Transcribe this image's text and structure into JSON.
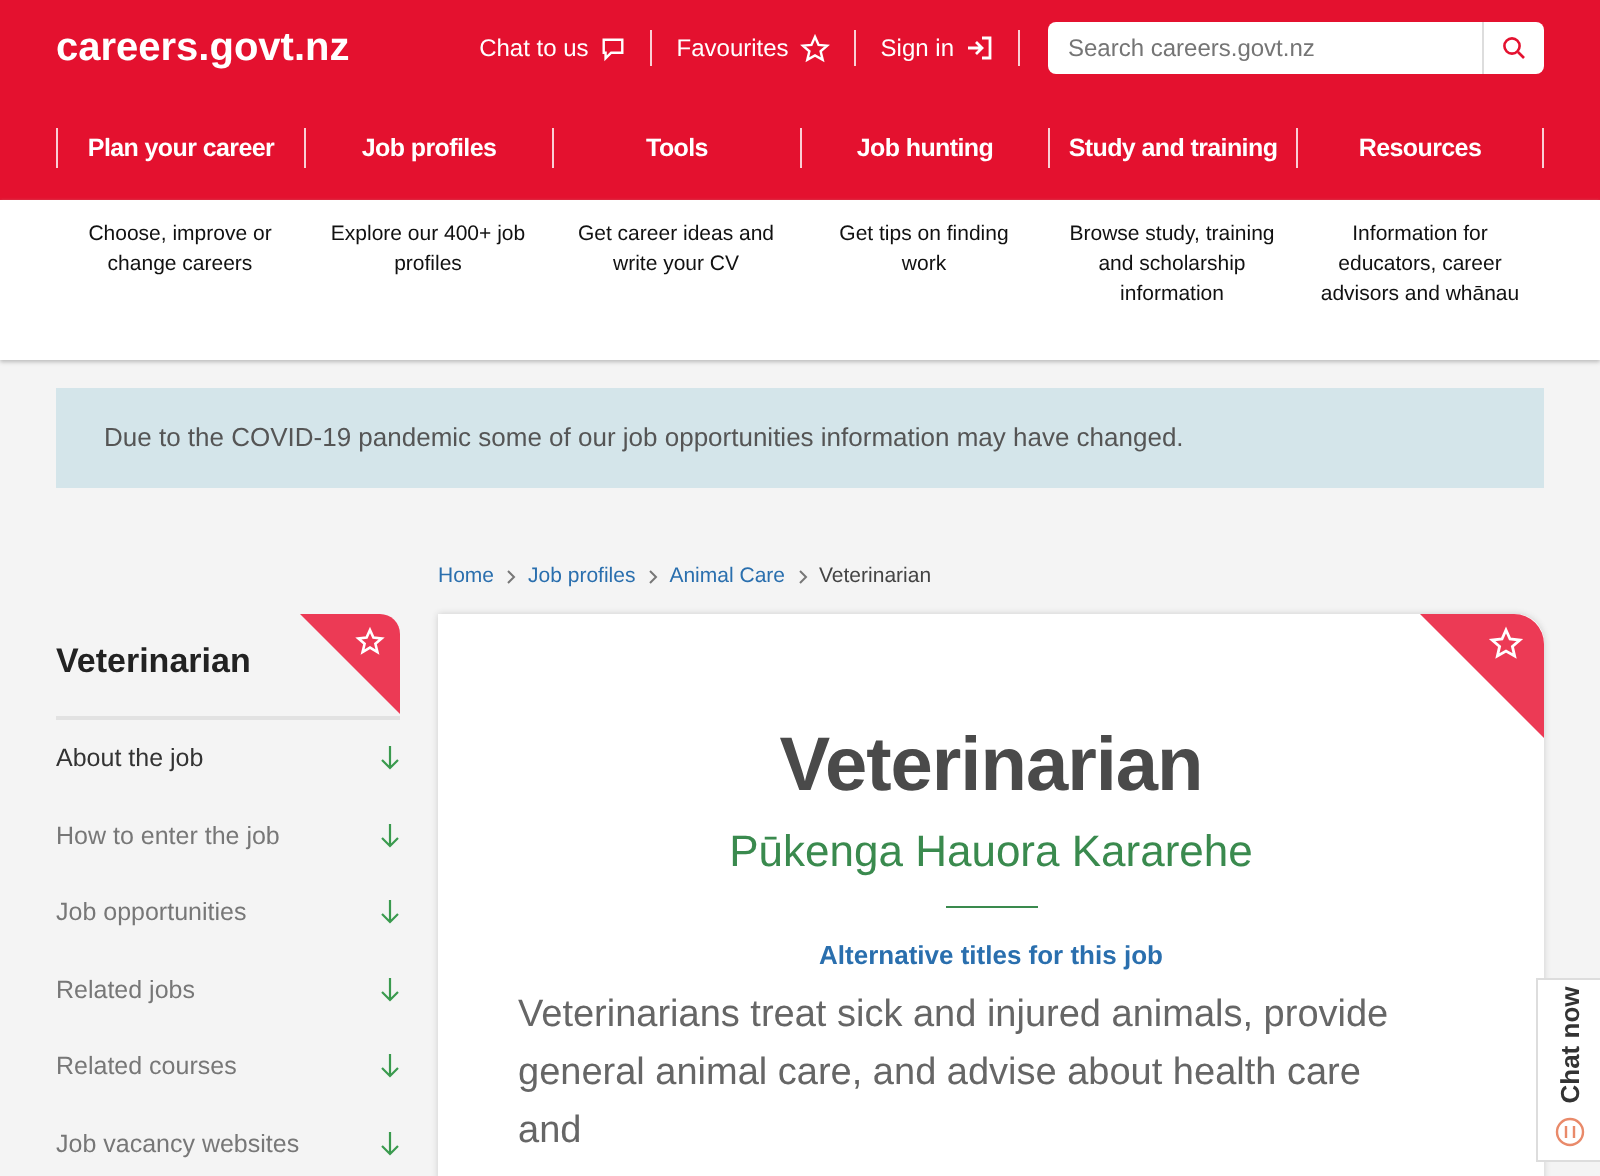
{
  "header": {
    "logo": "careers.govt.nz",
    "links": [
      {
        "label": "Chat to us",
        "kind": "chat"
      },
      {
        "label": "Favourites",
        "kind": "star"
      },
      {
        "label": "Sign in",
        "kind": "signin"
      }
    ],
    "search": {
      "placeholder": "Search careers.govt.nz"
    }
  },
  "nav": [
    {
      "label": "Plan your career",
      "description": "Choose, improve or change careers"
    },
    {
      "label": "Job profiles",
      "description": "Explore our 400+ job profiles"
    },
    {
      "label": "Tools",
      "description": "Get career ideas and write your CV"
    },
    {
      "label": "Job hunting",
      "description": "Get tips on finding work"
    },
    {
      "label": "Study and training",
      "description": "Browse study, training and scholarship information"
    },
    {
      "label": "Resources",
      "description": "Information for educators, career advisors and whānau"
    }
  ],
  "notice": "Due to the COVID-19 pandemic some of our job opportunities information may have changed.",
  "breadcrumb": [
    {
      "label": "Home",
      "link": true
    },
    {
      "label": "Job profiles",
      "link": true
    },
    {
      "label": "Animal Care",
      "link": true
    },
    {
      "label": "Veterinarian",
      "link": false
    }
  ],
  "sidebar": {
    "title": "Veterinarian",
    "items": [
      {
        "label": "About the job",
        "selected": true
      },
      {
        "label": "How to enter the job",
        "selected": false
      },
      {
        "label": "Job opportunities",
        "selected": false
      },
      {
        "label": "Related jobs",
        "selected": false
      },
      {
        "label": "Related courses",
        "selected": false
      },
      {
        "label": "Job vacancy websites",
        "selected": false
      }
    ]
  },
  "profile": {
    "title": "Veterinarian",
    "maori_title": "Pūkenga Hauora Kararehe",
    "alt_titles_link": "Alternative titles for this job",
    "summary": "Veterinarians treat sick and injured animals, provide general animal care, and advise about health care and"
  },
  "chat_tab": "Chat now"
}
